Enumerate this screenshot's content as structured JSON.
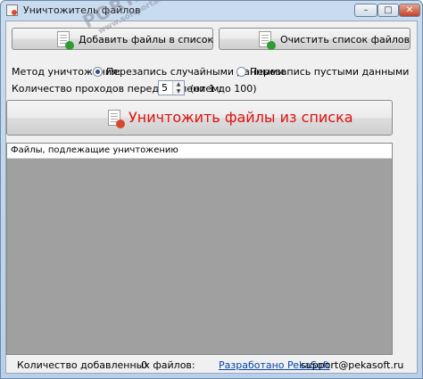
{
  "window": {
    "title": "Уничтожитель файлов",
    "controls": {
      "minimize": "–",
      "maximize": "□",
      "close": "✕"
    }
  },
  "toolbar": {
    "add_files_label": "Добавить файлы в список",
    "clear_list_label": "Очистить список файлов"
  },
  "method": {
    "label": "Метод уничтожения:",
    "options": [
      {
        "label": "Перезапись случайными данными",
        "selected": true
      },
      {
        "label": "Перезапись пустыми данными",
        "selected": false
      }
    ]
  },
  "passes": {
    "label": "Количество проходов перед удалением:",
    "value": "5",
    "range": "(от 1 до 100)"
  },
  "destroy_button_label": "Уничтожить файлы из списка",
  "file_list": {
    "column_header": "Файлы, подлежащие уничтожению",
    "rows": []
  },
  "status": {
    "count_label": "Количество добавленных файлов:",
    "count_value": "0",
    "developer_link": "Разработано PekaSoft",
    "support_email": "support@pekasoft.ru"
  },
  "watermark": {
    "text": "PORTAL",
    "sub": "www.softportal.com"
  },
  "colors": {
    "destroy_text": "#e01010",
    "link": "#0645ad",
    "list_background": "#a0a0a0"
  },
  "icons": {
    "app": "document-shred-icon",
    "add": "document-add-icon",
    "clear": "document-clear-icon",
    "destroy": "document-destroy-icon"
  }
}
